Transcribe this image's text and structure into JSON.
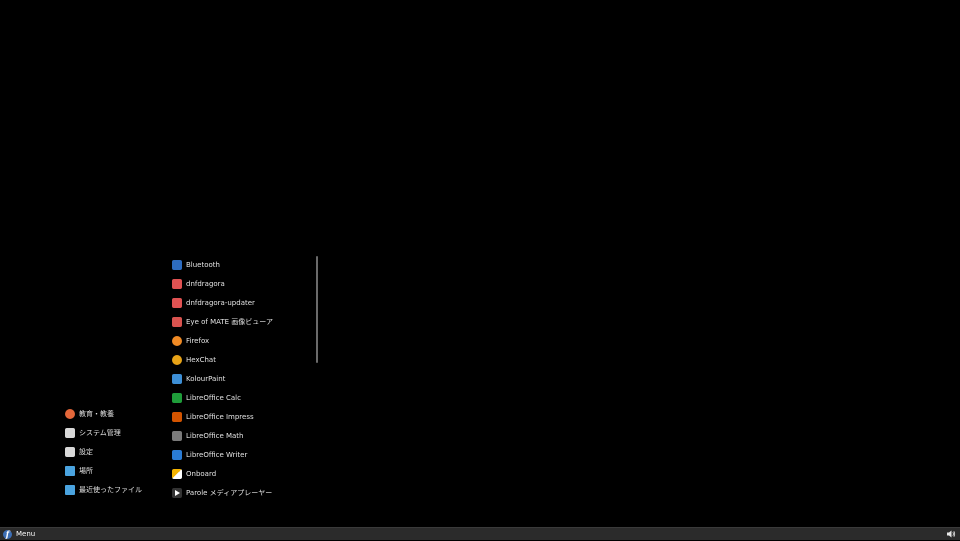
{
  "menu": {
    "categories": [
      {
        "label": "教育・教養",
        "icon": "education-icon",
        "color": "#e4673a"
      },
      {
        "label": "システム管理",
        "icon": "system-tools-icon",
        "color": "#d8d8d8"
      },
      {
        "label": "設定",
        "icon": "settings-icon",
        "color": "#d8d8d8"
      },
      {
        "label": "場所",
        "icon": "folder-icon",
        "color": "#4aa3df"
      },
      {
        "label": "最近使ったファイル",
        "icon": "folder-icon",
        "color": "#4aa3df"
      }
    ],
    "apps": [
      {
        "label": "Bluetooth",
        "icon": "bluetooth-icon",
        "color": "#2d6cc0"
      },
      {
        "label": "dnfdragora",
        "icon": "dnfdragora-icon",
        "color": "#e05252"
      },
      {
        "label": "dnfdragora-updater",
        "icon": "dnfdragora-updater-icon",
        "color": "#e05252"
      },
      {
        "label": "Eye of MATE 画像ビューア",
        "icon": "image-viewer-icon",
        "color": "#d9534f"
      },
      {
        "label": "Firefox",
        "icon": "firefox-icon",
        "color": "#f08a24"
      },
      {
        "label": "HexChat",
        "icon": "hexchat-icon",
        "color": "#e8a317"
      },
      {
        "label": "KolourPaint",
        "icon": "kolourpaint-icon",
        "color": "#3d8fd6"
      },
      {
        "label": "LibreOffice Calc",
        "icon": "libreoffice-calc-icon",
        "color": "#1f9d3a"
      },
      {
        "label": "LibreOffice Impress",
        "icon": "libreoffice-impress-icon",
        "color": "#d35400"
      },
      {
        "label": "LibreOffice Math",
        "icon": "libreoffice-math-icon",
        "color": "#7a7a7a"
      },
      {
        "label": "LibreOffice Writer",
        "icon": "libreoffice-writer-icon",
        "color": "#2a7bd4"
      },
      {
        "label": "Onboard",
        "icon": "onboard-icon",
        "color": "#f5b400"
      },
      {
        "label": "Parole メディアプレーヤー",
        "icon": "media-player-icon",
        "color": "#333333"
      }
    ]
  },
  "panel": {
    "menu_label": "Menu",
    "logo_glyph": "f",
    "tray_icon": "volume-icon"
  }
}
